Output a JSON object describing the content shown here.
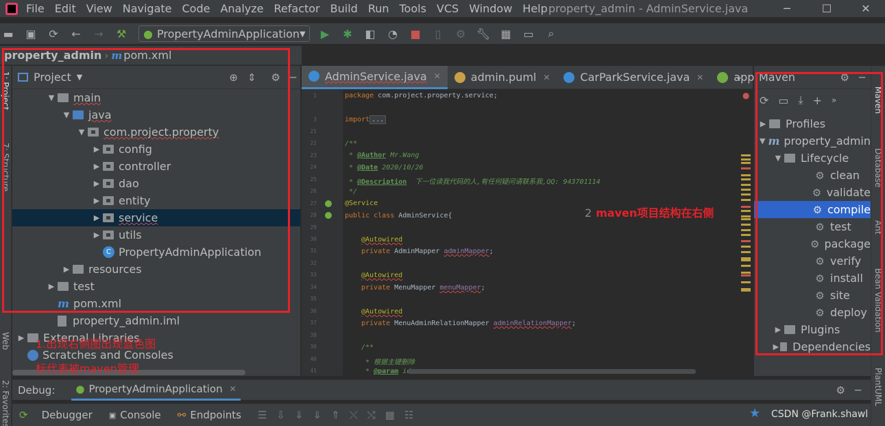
{
  "menubar": {
    "items": [
      "File",
      "Edit",
      "View",
      "Navigate",
      "Code",
      "Analyze",
      "Refactor",
      "Build",
      "Run",
      "Tools",
      "VCS",
      "Window",
      "Help"
    ],
    "window_title": "property_admin - AdminService.java"
  },
  "toolbar": {
    "run_config": "PropertyAdminApplication"
  },
  "navbar": {
    "project": "property_admin",
    "file": "pom.xml"
  },
  "left_strip": {
    "project_tab": "1: Project",
    "structure_tab": "7: Structure",
    "web_tab": "Web",
    "favorites_tab": "2: Favorites"
  },
  "project_panel": {
    "title": "Project",
    "tree": [
      {
        "label": "main",
        "depth": 2,
        "arrow": "open",
        "icon": "folder"
      },
      {
        "label": "java",
        "depth": 3,
        "arrow": "open",
        "icon": "folder-blue"
      },
      {
        "label": "com.project.property",
        "depth": 4,
        "arrow": "open",
        "icon": "package"
      },
      {
        "label": "config",
        "depth": 5,
        "arrow": "closed",
        "icon": "package"
      },
      {
        "label": "controller",
        "depth": 5,
        "arrow": "closed",
        "icon": "package"
      },
      {
        "label": "dao",
        "depth": 5,
        "arrow": "closed",
        "icon": "package"
      },
      {
        "label": "entity",
        "depth": 5,
        "arrow": "closed",
        "icon": "package"
      },
      {
        "label": "service",
        "depth": 5,
        "arrow": "closed",
        "icon": "package",
        "selected": true
      },
      {
        "label": "utils",
        "depth": 5,
        "arrow": "closed",
        "icon": "package"
      },
      {
        "label": "PropertyAdminApplication",
        "depth": 5,
        "arrow": "none",
        "icon": "spring-class"
      },
      {
        "label": "resources",
        "depth": 3,
        "arrow": "closed",
        "icon": "folder"
      },
      {
        "label": "test",
        "depth": 2,
        "arrow": "closed",
        "icon": "folder"
      },
      {
        "label": "pom.xml",
        "depth": 2,
        "arrow": "none",
        "icon": "maven"
      },
      {
        "label": "property_admin.iml",
        "depth": 2,
        "arrow": "none",
        "icon": "file"
      },
      {
        "label": "External Libraries",
        "depth": 0,
        "arrow": "closed",
        "icon": "library"
      },
      {
        "label": "Scratches and Consoles",
        "depth": 0,
        "arrow": "none",
        "icon": "scratch"
      }
    ]
  },
  "editor": {
    "tabs": [
      {
        "label": "AdminService.java",
        "active": true,
        "icon": "class"
      },
      {
        "label": "admin.puml",
        "active": false,
        "icon": "puml"
      },
      {
        "label": "CarParkService.java",
        "active": false,
        "icon": "class"
      },
      {
        "label": "applica",
        "active": false,
        "icon": "spring"
      }
    ],
    "line_numbers": [
      "1",
      "3",
      "21",
      "22",
      "23",
      "24",
      "25",
      "26",
      "27",
      "28",
      "29",
      "30",
      "31",
      "32",
      "33",
      "34",
      "35",
      "36",
      "37",
      "38",
      "39",
      "40",
      "41"
    ],
    "code": {
      "package_kw": "package",
      "package_name": " com.project.property.service;",
      "import_kw": "import",
      "import_fold": "...",
      "doc_open": "/**",
      "author_tag": "@Author",
      "author_val": " Mr.Wang",
      "date_tag": "@Date",
      "date_val": " 2020/10/26",
      "desc_tag": "@Description",
      "desc_val": "  下一位读我代码的人,有任何疑问请联系我,QQ: 943701114",
      "doc_close": " */",
      "service_ann": "@Service",
      "public_kw": "public class",
      "class_name": " AdminService{",
      "autowired": "@Autowired",
      "private_kw": "private",
      "f1_type": " AdminMapper ",
      "f1_name": "adminMapper",
      "f2_type": " MenuMapper ",
      "f2_name": "menuMapper",
      "f3_type": " MenuAdminRelationMapper ",
      "f3_name": "adminRelationMapper",
      "semi": ";",
      "doc2_open": "/**",
      "doc2_line": " * 根据主键删除",
      "param_tag": "@param",
      "param_val": " id"
    }
  },
  "maven_panel": {
    "title": "Maven",
    "rows": [
      {
        "label": "Profiles",
        "indent": 0,
        "arrow": "closed",
        "icon": "profiles"
      },
      {
        "label": "property_admin",
        "indent": 0,
        "arrow": "open",
        "icon": "maven"
      },
      {
        "label": "Lifecycle",
        "indent": 1,
        "arrow": "open",
        "icon": "folder"
      },
      {
        "label": "clean",
        "indent": 2,
        "arrow": "none",
        "icon": "gear"
      },
      {
        "label": "validate",
        "indent": 2,
        "arrow": "none",
        "icon": "gear"
      },
      {
        "label": "compile",
        "indent": 2,
        "arrow": "none",
        "icon": "gear",
        "selected": true
      },
      {
        "label": "test",
        "indent": 2,
        "arrow": "none",
        "icon": "gear"
      },
      {
        "label": "package",
        "indent": 2,
        "arrow": "none",
        "icon": "gear"
      },
      {
        "label": "verify",
        "indent": 2,
        "arrow": "none",
        "icon": "gear"
      },
      {
        "label": "install",
        "indent": 2,
        "arrow": "none",
        "icon": "gear"
      },
      {
        "label": "site",
        "indent": 2,
        "arrow": "none",
        "icon": "gear"
      },
      {
        "label": "deploy",
        "indent": 2,
        "arrow": "none",
        "icon": "gear"
      },
      {
        "label": "Plugins",
        "indent": 1,
        "arrow": "closed",
        "icon": "folder"
      },
      {
        "label": "Dependencies",
        "indent": 1,
        "arrow": "closed",
        "icon": "deps"
      }
    ]
  },
  "right_strip": {
    "maven_tab": "Maven",
    "database_tab": "Database",
    "ant_tab": "Ant",
    "bean_tab": "Bean Validation",
    "plantuml_tab": "PlantUML"
  },
  "debug": {
    "label": "Debug:",
    "session": "PropertyAdminApplication",
    "tabs": [
      "Debugger",
      "Console",
      "Endpoints"
    ]
  },
  "annotations": {
    "right_note_num": "2",
    "right_note_text": "maven项目结构在右侧",
    "left_note_line1": "1.出现右侧图出现蓝色图",
    "left_note_line2": "标代表被maven管理"
  },
  "watermark": "CSDN @Frank.shawl",
  "colors": {
    "accent_red": "#e5222b",
    "selection_blue": "#2f65ca",
    "tree_selection": "#0d293e",
    "background": "#2b2b2b",
    "panel": "#3c3f41"
  }
}
